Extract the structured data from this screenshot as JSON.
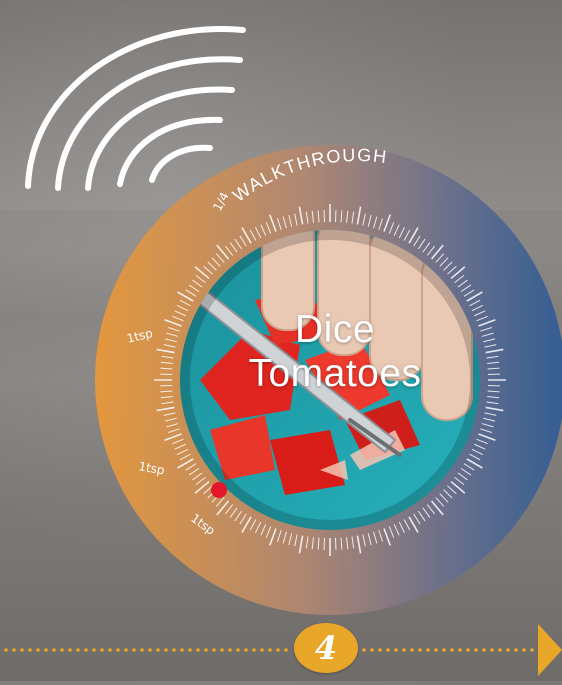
{
  "dial": {
    "label": "WALKTHROUGH",
    "scale_labels": [
      "1/4",
      "1tsp",
      "1tsp",
      "1tsp"
    ],
    "progress_marker": 0.62
  },
  "step": {
    "title_line1": "Dice",
    "title_line2": "Tomatoes",
    "number": "4"
  },
  "icons": {
    "signal": "signal-waves-icon",
    "next": "next-arrow-icon"
  },
  "colors": {
    "ring_warm": "#e8983a",
    "ring_cool": "#2f5c94",
    "badge": "#e9a72a",
    "dots": "#e9a72a",
    "marker": "#e3162b",
    "board": "#1fa3ad"
  }
}
